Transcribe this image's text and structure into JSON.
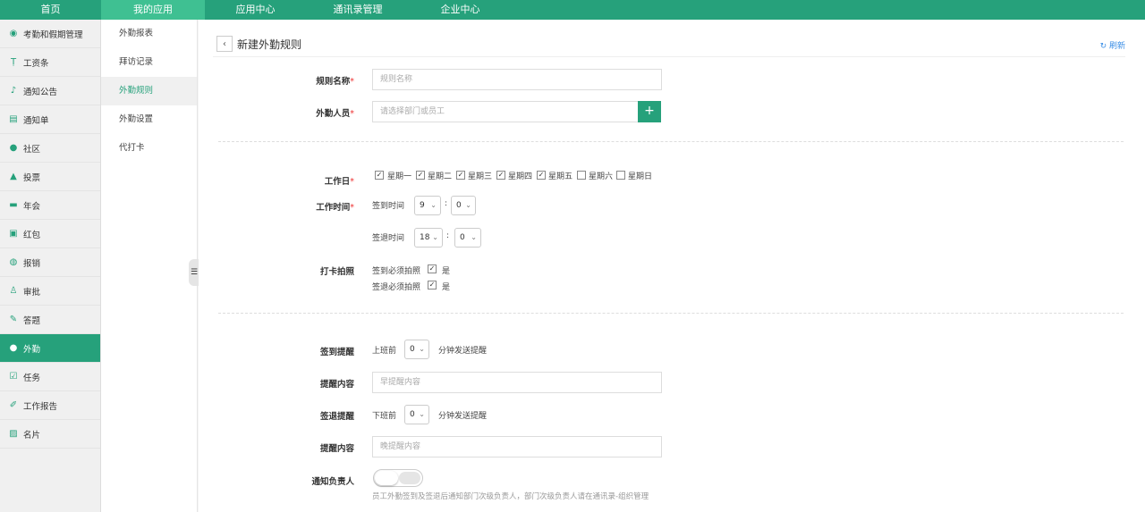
{
  "topnav": {
    "tabs": [
      {
        "label": "首页"
      },
      {
        "label": "我的应用"
      },
      {
        "label": "应用中心"
      },
      {
        "label": "通讯录管理"
      },
      {
        "label": "企业中心"
      }
    ],
    "active": "我的应用"
  },
  "sidebar": {
    "items": [
      {
        "label": "考勤和假期管理",
        "icon": "attendance-icon"
      },
      {
        "label": "工资条",
        "icon": "salary-icon"
      },
      {
        "label": "通知公告",
        "icon": "bell-icon"
      },
      {
        "label": "通知单",
        "icon": "notice-icon"
      },
      {
        "label": "社区",
        "icon": "chat-icon"
      },
      {
        "label": "投票",
        "icon": "vote-icon"
      },
      {
        "label": "年会",
        "icon": "party-icon"
      },
      {
        "label": "红包",
        "icon": "redpacket-icon"
      },
      {
        "label": "报销",
        "icon": "reimburse-icon"
      },
      {
        "label": "审批",
        "icon": "approval-icon"
      },
      {
        "label": "答题",
        "icon": "quiz-icon"
      },
      {
        "label": "外勤",
        "icon": "location-pin-icon"
      },
      {
        "label": "任务",
        "icon": "task-icon"
      },
      {
        "label": "工作报告",
        "icon": "report-icon"
      },
      {
        "label": "名片",
        "icon": "card-icon"
      }
    ],
    "active": "外勤"
  },
  "subnav": {
    "items": [
      {
        "label": "外勤报表"
      },
      {
        "label": "拜访记录"
      },
      {
        "label": "外勤规则"
      },
      {
        "label": "外勤设置"
      },
      {
        "label": "代打卡"
      }
    ],
    "active": "外勤规则"
  },
  "header": {
    "title": "新建外勤规则",
    "refresh": "刷新",
    "back_icon": "chevron-left-icon",
    "refresh_icon": "refresh-icon"
  },
  "form": {
    "rule_name": {
      "label": "规则名称",
      "placeholder": "规则名称",
      "value": ""
    },
    "members": {
      "label": "外勤人员",
      "placeholder": "请选择部门或员工",
      "value": "",
      "add_icon": "plus-icon"
    },
    "workdays": {
      "label": "工作日",
      "days": [
        {
          "label": "星期一",
          "checked": true
        },
        {
          "label": "星期二",
          "checked": true
        },
        {
          "label": "星期三",
          "checked": true
        },
        {
          "label": "星期四",
          "checked": true
        },
        {
          "label": "星期五",
          "checked": true
        },
        {
          "label": "星期六",
          "checked": false
        },
        {
          "label": "星期日",
          "checked": false
        }
      ]
    },
    "worktime": {
      "label": "工作时间",
      "checkin_label": "签到时间",
      "checkin_hour": "9",
      "checkin_min": "0",
      "checkout_label": "签退时间",
      "checkout_hour": "18",
      "checkout_min": "0",
      "sep": ":"
    },
    "photo": {
      "label": "打卡拍照",
      "checkin_label": "签到必须拍照",
      "checkin_value": "是",
      "checkin_checked": true,
      "checkout_label": "签退必须拍照",
      "checkout_value": "是",
      "checkout_checked": true
    },
    "checkin_remind": {
      "label": "签到提醒",
      "prefix": "上班前",
      "value": "0",
      "suffix": "分钟发送提醒"
    },
    "checkin_content": {
      "label": "提醒内容",
      "placeholder": "早提醒内容",
      "value": ""
    },
    "checkout_remind": {
      "label": "签退提醒",
      "prefix": "下班前",
      "value": "0",
      "suffix": "分钟发送提醒"
    },
    "checkout_content": {
      "label": "提醒内容",
      "placeholder": "晚提醒内容",
      "value": ""
    },
    "notify_leader": {
      "label": "通知负责人",
      "enabled": false,
      "description": "员工外勤签到及签退后通知部门次级负责人，部门次级负责人请在通讯录-组织管理"
    }
  },
  "colors": {
    "brand": "#26a17b",
    "brand_light": "#3fc092",
    "required": "#e33333",
    "link": "#3a8ee6"
  }
}
